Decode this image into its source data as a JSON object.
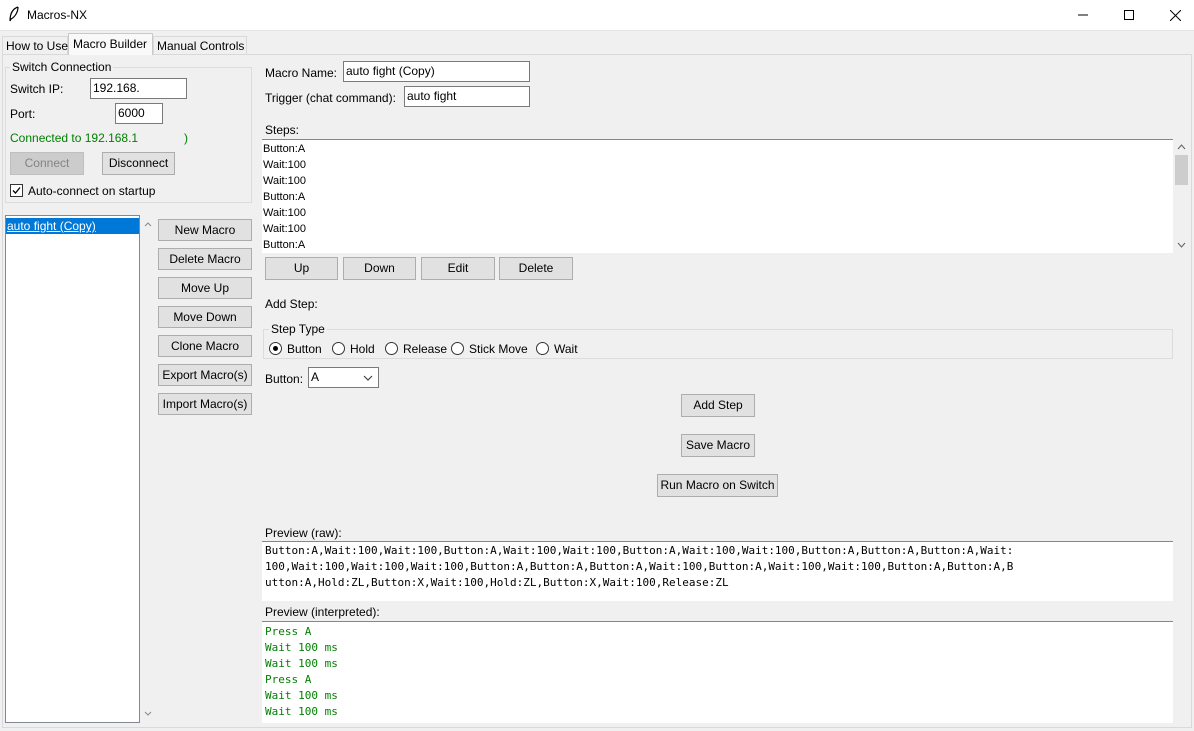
{
  "window": {
    "title": "Macros-NX",
    "minimize": "—",
    "maximize": "☐",
    "close": "✕"
  },
  "tabs": [
    {
      "label": "How to Use"
    },
    {
      "label": "Macro Builder"
    },
    {
      "label": "Manual Controls"
    }
  ],
  "connection": {
    "group_title": "Switch Connection",
    "ip_label": "Switch IP:",
    "ip_value": "192.168.",
    "port_label": "Port:",
    "port_value": "6000",
    "status": "Connected to 192.168.1",
    "status_tail": ")",
    "connect_label": "Connect",
    "disconnect_label": "Disconnect",
    "autoconnect_label": "Auto-connect on startup",
    "autoconnect_checked": true
  },
  "macro_list": {
    "items": [
      "auto fight (Copy)"
    ],
    "selected": "auto fight (Copy)"
  },
  "macro_buttons": {
    "new": "New Macro",
    "delete": "Delete Macro",
    "move_up": "Move Up",
    "move_down": "Move Down",
    "clone": "Clone Macro",
    "export": "Export Macro(s)",
    "import": "Import Macro(s)"
  },
  "editor": {
    "name_label": "Macro Name:",
    "name_value": "auto fight (Copy)",
    "trigger_label": "Trigger (chat command):",
    "trigger_value": "auto fight",
    "steps_label": "Steps:",
    "steps": [
      "Button:A",
      "Wait:100",
      "Wait:100",
      "Button:A",
      "Wait:100",
      "Wait:100",
      "Button:A"
    ],
    "step_buttons": {
      "up": "Up",
      "down": "Down",
      "edit": "Edit",
      "delete": "Delete"
    },
    "add_step_label": "Add Step:",
    "step_type_title": "Step Type",
    "step_types": [
      "Button",
      "Hold",
      "Release",
      "Stick Move",
      "Wait"
    ],
    "step_type_selected": "Button",
    "button_label": "Button:",
    "button_value": "A",
    "add_step_button": "Add Step",
    "save_button": "Save Macro",
    "run_button": "Run Macro on Switch"
  },
  "preview_raw": {
    "label": "Preview (raw):",
    "lines": [
      "Button:A,Wait:100,Wait:100,Button:A,Wait:100,Wait:100,Button:A,Wait:100,Wait:100,Button:A,Button:A,Button:A,Wait:",
      "100,Wait:100,Wait:100,Wait:100,Button:A,Button:A,Button:A,Wait:100,Button:A,Wait:100,Wait:100,Button:A,Button:A,B",
      "utton:A,Hold:ZL,Button:X,Wait:100,Hold:ZL,Button:X,Wait:100,Release:ZL"
    ]
  },
  "preview_interpreted": {
    "label": "Preview (interpreted):",
    "lines": [
      "Press A",
      "Wait 100 ms",
      "Wait 100 ms",
      "Press A",
      "Wait 100 ms",
      "Wait 100 ms"
    ]
  },
  "colors": {
    "selection": "#0078d7",
    "status_green": "#008000"
  }
}
